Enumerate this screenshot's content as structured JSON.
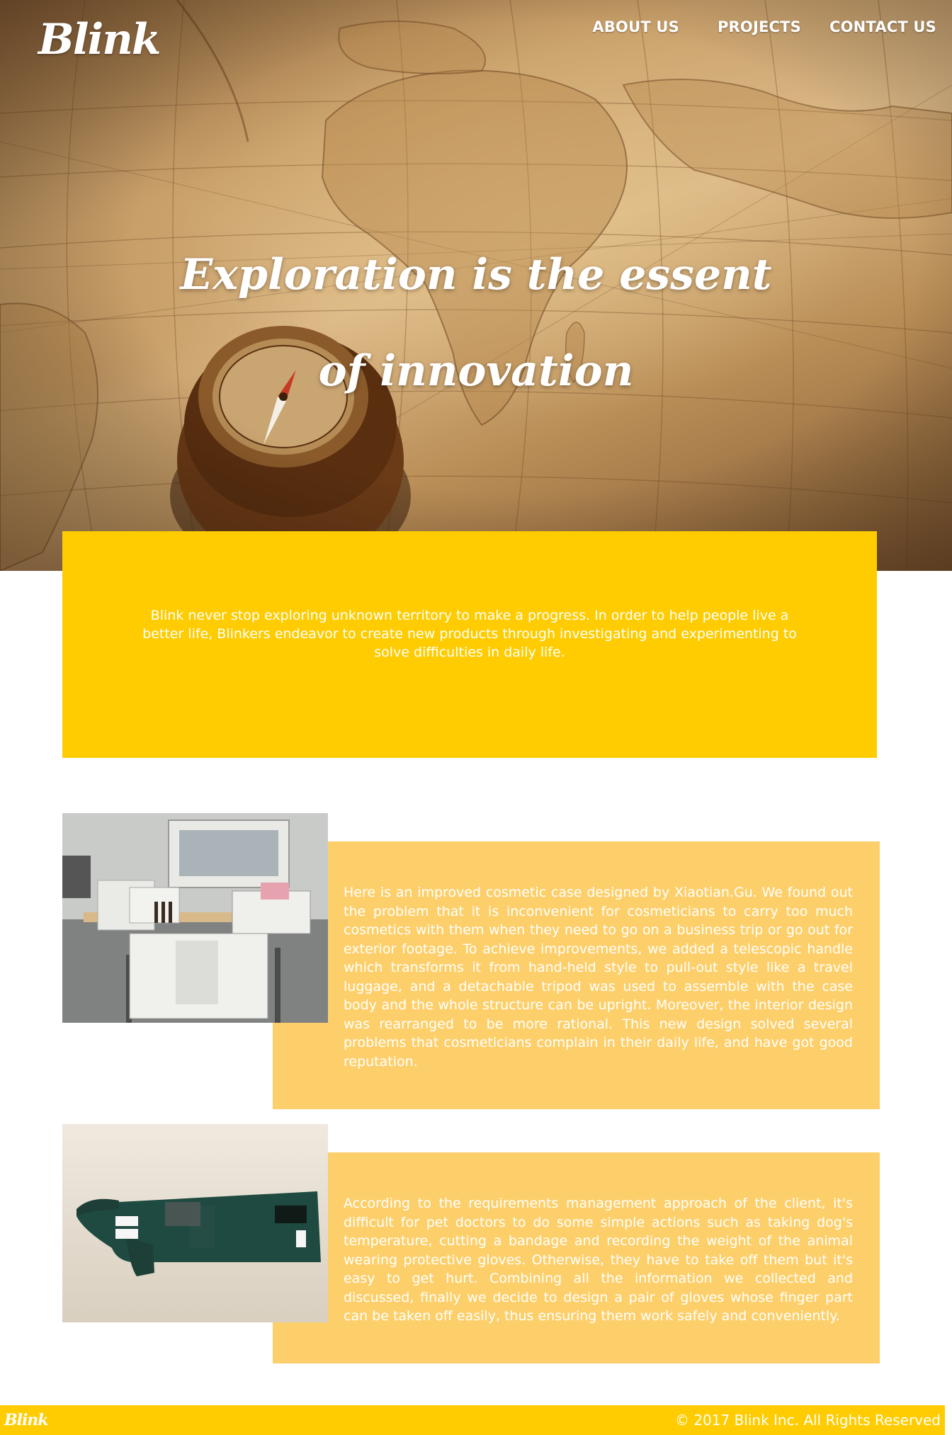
{
  "brand": {
    "logo": "Blink"
  },
  "nav": {
    "items": [
      "ABOUT US",
      "PROJECTS",
      "CONTACT US"
    ]
  },
  "hero": {
    "title_line1": "Exploration is the essent",
    "title_line2": "of innovation"
  },
  "intro": {
    "text": "Blink never stop exploring unknown territory to make a progress. In order to help people live a better life, Blinkers endeavor to create new products through investigating and experimenting to solve difficulties in daily life."
  },
  "projects": [
    {
      "image": "cosmetic-case-photo",
      "text": "Here is an improved cosmetic case designed by Xiaotian.Gu. We found out the problem that it is inconvenient for cosmeticians to carry too much cosmetics with them when they need to go on a business trip or go out for exterior footage. To achieve improvements, we added a telescopic handle which transforms it from hand-held style to pull-out style like a travel luggage, and a detachable tripod was used to assemble with the case body and the whole structure can be upright. Moreover, the interior design was rearranged to be more rational. This new design solved several problems that cosmeticians complain in their daily life, and have got good reputation."
    },
    {
      "image": "protective-glove-photo",
      "text": "According to the requirements management approach of the client, it's difficult for pet doctors to do some simple actions such as taking dog's temperature, cutting a bandage and recording the weight of the animal wearing protective gloves. Otherwise, they have to take off them but it's easy to get hurt. Combining all the information we collected and discussed, finally we decide to design a pair of gloves whose finger part can be taken off easily, thus ensuring them work safely and conveniently."
    }
  ],
  "footer": {
    "logo": "Blink",
    "copyright": "© 2017 Blink Inc. All Rights Reserved"
  },
  "colors": {
    "accent_yellow": "#fecc00",
    "card_yellow": "#fdcf6a",
    "text_white": "#ffffff"
  }
}
